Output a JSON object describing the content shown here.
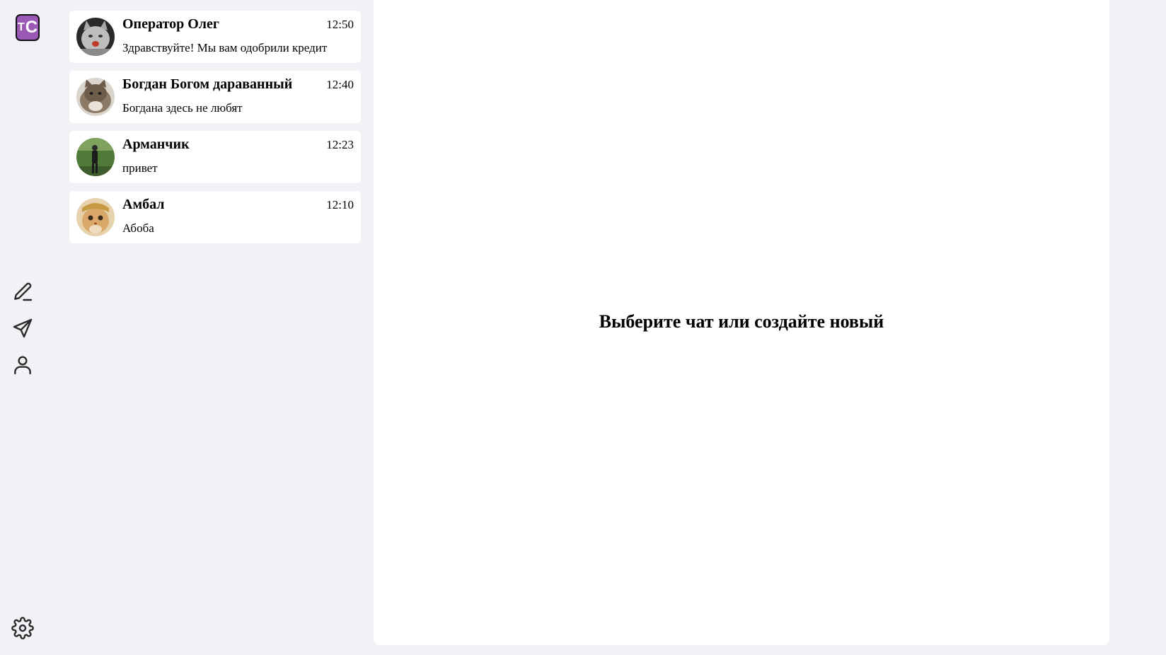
{
  "logo": {
    "letter_t": "T",
    "letter_c": "C",
    "color": "#9b59b6"
  },
  "rail": {
    "icons": [
      "pencil-icon",
      "send-icon",
      "user-icon",
      "settings-icon"
    ]
  },
  "chats": [
    {
      "name": "Оператор Олег",
      "time": "12:50",
      "preview": "Здравствуйте! Мы вам одобрили кредит"
    },
    {
      "name": "Богдан Богом дараванный",
      "time": "12:40",
      "preview": "Богдана здесь не любят"
    },
    {
      "name": "Арманчик",
      "time": "12:23",
      "preview": "привет"
    },
    {
      "name": "Амбал",
      "time": "12:10",
      "preview": "Абоба"
    }
  ],
  "main": {
    "placeholder": "Выберите чат или создайте новый"
  }
}
